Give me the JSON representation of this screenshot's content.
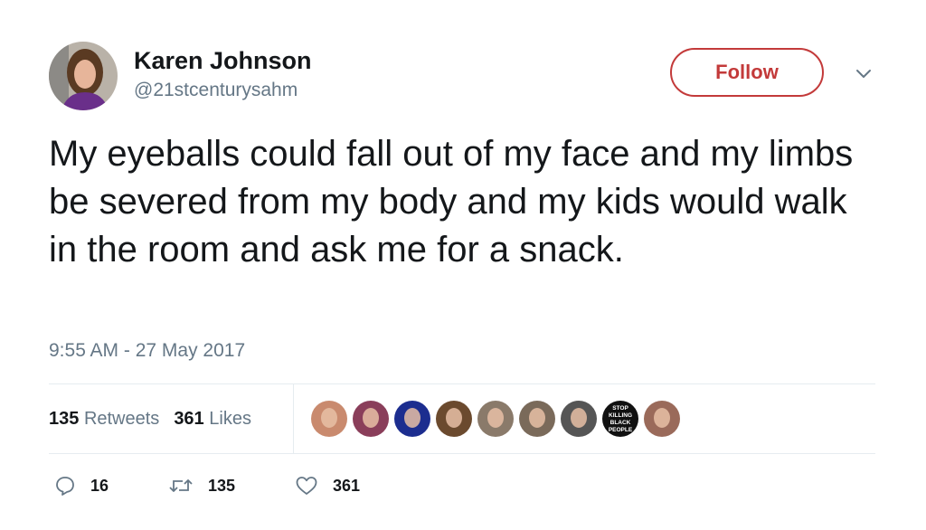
{
  "author": {
    "name": "Karen Johnson",
    "handle": "@21stcenturysahm"
  },
  "follow_label": "Follow",
  "tweet": {
    "text": "My eyeballs could fall out of my face and my limbs be severed from my body and my kids would walk in the room and ask me for a snack.",
    "timestamp": "9:55 AM - 27 May 2017"
  },
  "stats": {
    "retweets_count": "135",
    "retweets_label": "Retweets",
    "likes_count": "361",
    "likes_label": "Likes"
  },
  "liker_avatars": [
    {
      "name": "liker-avatar-1",
      "color": "#c98a6e"
    },
    {
      "name": "liker-avatar-2",
      "color": "#8a3e5a"
    },
    {
      "name": "liker-avatar-3",
      "color": "#1c2d8f"
    },
    {
      "name": "liker-avatar-4",
      "color": "#6b4a2e"
    },
    {
      "name": "liker-avatar-5",
      "color": "#8a7a6a"
    },
    {
      "name": "liker-avatar-6",
      "color": "#7a6a5a"
    },
    {
      "name": "liker-avatar-7",
      "color": "#555555"
    },
    {
      "name": "liker-avatar-8",
      "color": "#111111",
      "text": "STOP KILLING BLACK PEOPLE"
    },
    {
      "name": "liker-avatar-9",
      "color": "#9a6a5a"
    }
  ],
  "actions": {
    "reply_count": "16",
    "retweet_count": "135",
    "like_count": "361"
  },
  "colors": {
    "follow_accent": "#c33a3a",
    "secondary_text": "#657786",
    "icon_gray": "#657786",
    "divider": "#e6ecf0"
  }
}
